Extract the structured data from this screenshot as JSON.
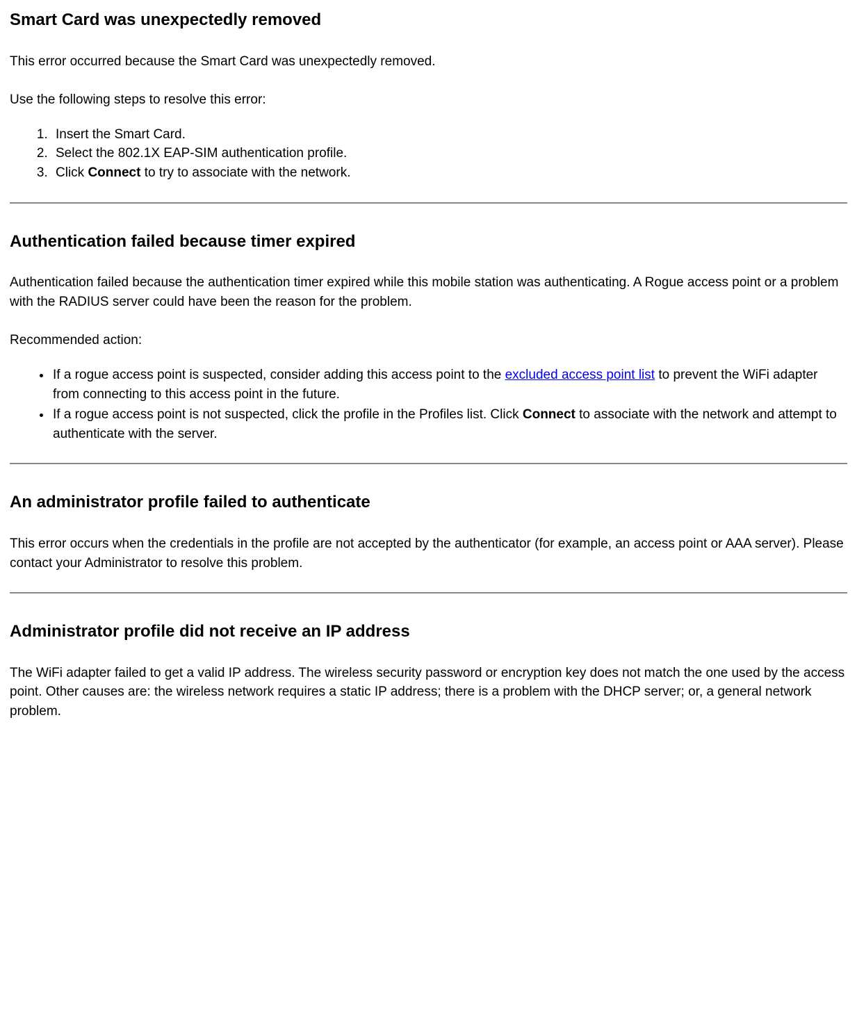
{
  "section1": {
    "heading": "Smart Card was unexpectedly removed",
    "p1": "This error occurred because the Smart Card was unexpectedly removed.",
    "p2": "Use the following steps to resolve this error:",
    "steps": {
      "s1": "Insert the Smart Card.",
      "s2": "Select the 802.1X EAP-SIM authentication profile.",
      "s3_pre": "Click ",
      "s3_bold": "Connect",
      "s3_post": " to try to associate with the network."
    }
  },
  "section2": {
    "heading": "Authentication failed because timer expired",
    "p1": "Authentication failed because the authentication timer expired while this mobile station was authenticating. A Rogue access point or a problem with the RADIUS server could have been the reason for the problem.",
    "p2": "Recommended action:",
    "bullets": {
      "b1_pre": "If a rogue access point is suspected, consider adding this access point to the ",
      "b1_link": "excluded access point list",
      "b1_post": " to prevent the WiFi adapter from connecting to this access point in the future.",
      "b2_pre": "If a rogue access point is not suspected, click the profile in the Profiles list. Click ",
      "b2_bold": "Connect",
      "b2_post": " to associate with the network and attempt to authenticate with the server."
    }
  },
  "section3": {
    "heading": "An administrator profile failed to authenticate",
    "p1": "This error occurs when the credentials in the profile are not accepted by the authenticator (for example, an access point or AAA server). Please contact your Administrator to resolve this problem."
  },
  "section4": {
    "heading": "Administrator profile did not receive an IP address",
    "p1": "The WiFi adapter failed to get a valid IP address. The wireless security password or encryption key does not match the one used by the access point. Other causes are: the wireless network requires a static IP address; there is a problem with the DHCP server; or, a general network problem."
  }
}
